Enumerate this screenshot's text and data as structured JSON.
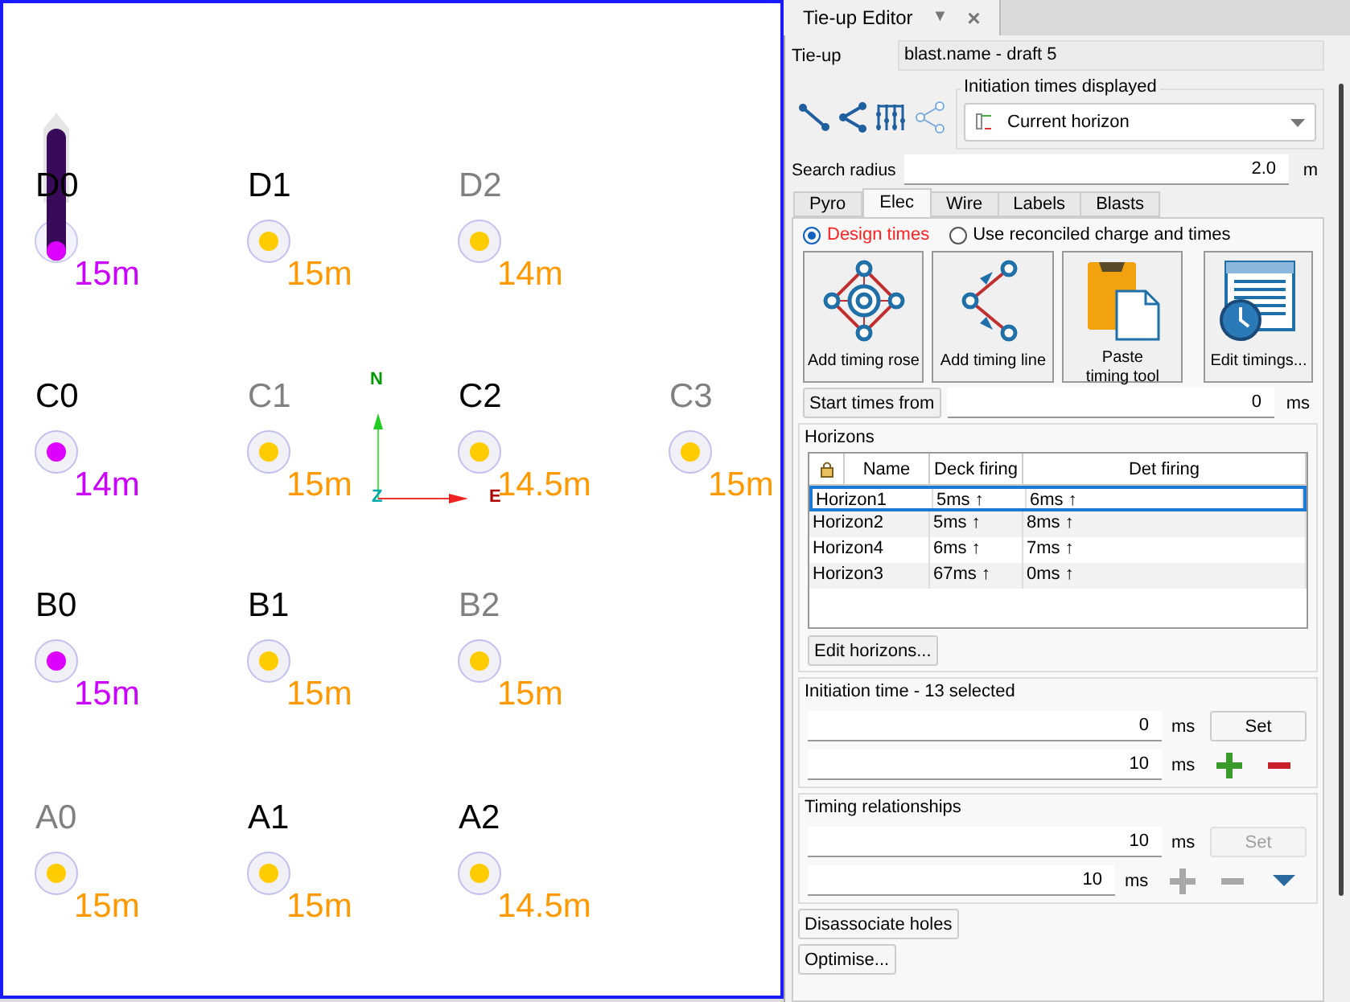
{
  "viewport": {
    "rows": [
      {
        "holes": [
          {
            "label": "D0",
            "dimmed": false,
            "kind": "vertical",
            "depth": "15m"
          },
          {
            "label": "D1",
            "dimmed": false,
            "kind": "normal",
            "depth": "15m"
          },
          {
            "label": "D2",
            "dimmed": true,
            "kind": "normal",
            "depth": "14m"
          }
        ]
      },
      {
        "holes": [
          {
            "label": "C0",
            "dimmed": false,
            "kind": "start",
            "depth": "14m"
          },
          {
            "label": "C1",
            "dimmed": true,
            "kind": "normal",
            "depth": "15m"
          },
          {
            "label": "C2",
            "dimmed": false,
            "kind": "normal",
            "depth": "14.5m"
          },
          {
            "label": "C3",
            "dimmed": true,
            "kind": "normal",
            "depth": "15m"
          }
        ]
      },
      {
        "holes": [
          {
            "label": "B0",
            "dimmed": false,
            "kind": "start",
            "depth": "15m"
          },
          {
            "label": "B1",
            "dimmed": false,
            "kind": "normal",
            "depth": "15m"
          },
          {
            "label": "B2",
            "dimmed": true,
            "kind": "normal",
            "depth": "15m"
          }
        ]
      },
      {
        "holes": [
          {
            "label": "A0",
            "dimmed": true,
            "kind": "normal",
            "depth": "15m"
          },
          {
            "label": "A1",
            "dimmed": false,
            "kind": "normal",
            "depth": "15m"
          },
          {
            "label": "A2",
            "dimmed": false,
            "kind": "normal",
            "depth": "14.5m"
          }
        ]
      }
    ],
    "axes": {
      "north": "N",
      "east": "E",
      "up": "Z"
    }
  },
  "panel": {
    "tab": {
      "title": "Tie-up Editor",
      "menu": "▼",
      "close": "×"
    },
    "tie_up": {
      "label": "Tie-up",
      "value": "blast.name - draft 5"
    },
    "initiation_times_displayed": {
      "title": "Initiation times displayed",
      "value": "Current horizon"
    },
    "search_radius": {
      "label": "Search radius",
      "value": "2.0",
      "unit": "m"
    },
    "tabs": [
      {
        "label": "Pyro",
        "selected": false
      },
      {
        "label": "Elec",
        "selected": true
      },
      {
        "label": "Wire",
        "selected": false
      },
      {
        "label": "Labels",
        "selected": false
      },
      {
        "label": "Blasts",
        "selected": false
      }
    ],
    "mode": [
      {
        "label": "Design times",
        "selected": true
      },
      {
        "label": "Use reconciled charge and times",
        "selected": false
      }
    ],
    "tools": [
      {
        "kind": "rose",
        "label": "Add timing rose"
      },
      {
        "kind": "line",
        "label": "Add timing line"
      },
      {
        "kind": "paste",
        "label": "Paste timing tool"
      },
      {
        "kind": "table",
        "label": "Edit timings..."
      }
    ],
    "start_times": {
      "button": "Start times from",
      "value": "0",
      "unit": "ms"
    },
    "horizons": {
      "title": "Horizons",
      "columns": [
        "Name",
        "Deck firing",
        "Det firing"
      ],
      "rows": [
        {
          "cells": [
            "Horizon1",
            "5ms ↑",
            "6ms ↑"
          ],
          "selected": true
        },
        {
          "cells": [
            "Horizon2",
            "5ms ↑",
            "8ms ↑"
          ],
          "selected": false
        },
        {
          "cells": [
            "Horizon4",
            "6ms ↑",
            "7ms ↑"
          ],
          "selected": false
        },
        {
          "cells": [
            "Horizon3",
            "67ms ↑",
            "0ms ↑"
          ],
          "selected": false
        }
      ],
      "button": "Edit horizons..."
    },
    "initiation_time": {
      "title": "Initiation time - 13 selected",
      "set_value": "0",
      "unit": "ms",
      "set": "Set",
      "step_value": "10",
      "step_unit": "ms",
      "disabled": false
    },
    "timing_relationships": {
      "title": "Timing relationships",
      "set_value": "10",
      "unit": "ms",
      "set": "Set",
      "step_value": "10",
      "step_unit": "ms",
      "disabled": true
    },
    "buttons": [
      "Disassociate holes",
      "Optimise..."
    ]
  }
}
